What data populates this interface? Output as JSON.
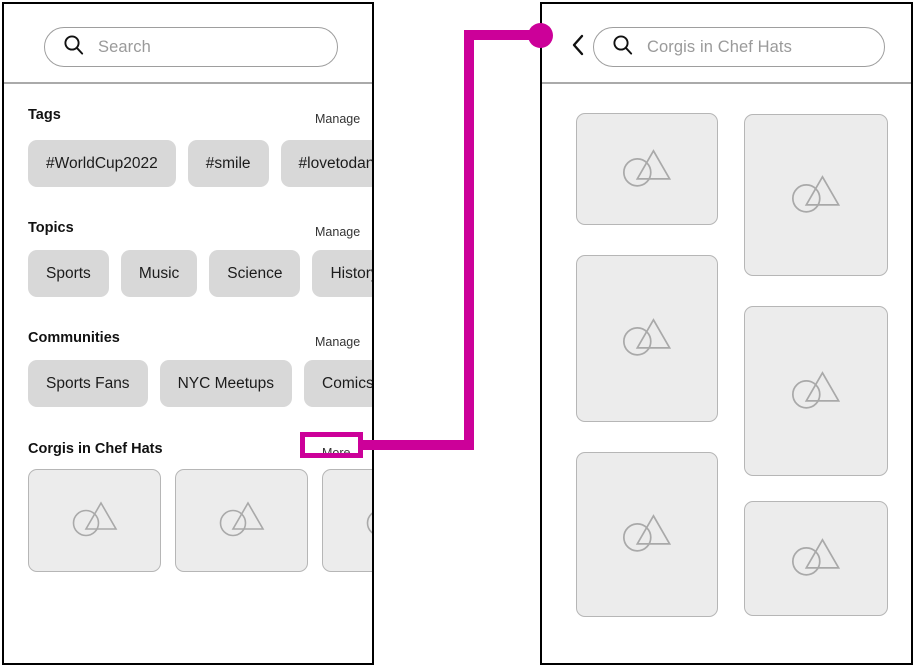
{
  "annotation": {
    "accent_color": "#cc0099",
    "target_label": "More",
    "description": "connector from More button to detail screen"
  },
  "left_screen": {
    "name": "discover-screen",
    "search": {
      "icon": "search-icon",
      "value": "",
      "placeholder": "Search"
    },
    "sections": [
      {
        "title": "Tags",
        "action": "Manage",
        "chips": [
          "#WorldCup2022",
          "#smile",
          "#lovetodance"
        ]
      },
      {
        "title": "Topics",
        "action": "Manage",
        "chips": [
          "Sports",
          "Music",
          "Science",
          "History"
        ]
      },
      {
        "title": "Communities",
        "action": "Manage",
        "chips": [
          "Sports Fans",
          "NYC Meetups",
          "Comics"
        ]
      }
    ],
    "gallery_section": {
      "title": "Corgis in Chef Hats",
      "action": "More",
      "thumbnails": [
        {
          "icon": "image-placeholder-icon"
        },
        {
          "icon": "image-placeholder-icon"
        },
        {
          "icon": "image-placeholder-icon"
        }
      ]
    }
  },
  "right_screen": {
    "name": "search-results-screen",
    "back_icon": "chevron-left-icon",
    "search": {
      "icon": "search-icon",
      "value": "",
      "placeholder": "Corgis in Chef Hats"
    },
    "results_grid": {
      "columns": 2,
      "items": [
        {
          "icon": "image-placeholder-icon",
          "column": "left"
        },
        {
          "icon": "image-placeholder-icon",
          "column": "right"
        },
        {
          "icon": "image-placeholder-icon",
          "column": "left"
        },
        {
          "icon": "image-placeholder-icon",
          "column": "right"
        },
        {
          "icon": "image-placeholder-icon",
          "column": "left"
        },
        {
          "icon": "image-placeholder-icon",
          "column": "right"
        }
      ]
    }
  }
}
